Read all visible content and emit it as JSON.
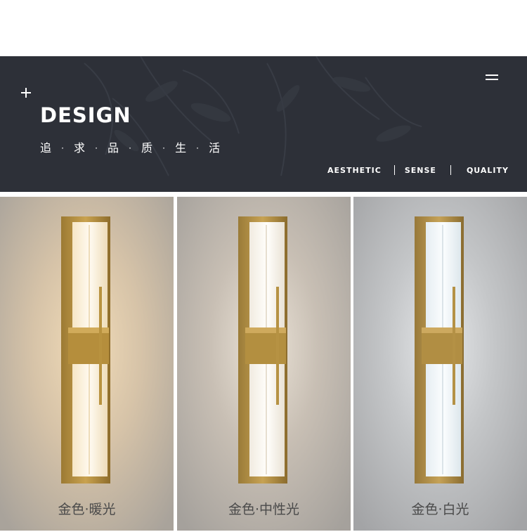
{
  "banner": {
    "title": "DESIGN",
    "slogan_chars": [
      "追",
      "求",
      "品",
      "质",
      "生",
      "活"
    ],
    "slogan_separator": "·",
    "keywords": [
      "AESTHETIC",
      "SENSE",
      "QUALITY"
    ],
    "background_color": "#2d3038",
    "icons": [
      "plus-icon",
      "menu-icon"
    ]
  },
  "variants": [
    {
      "caption": "金色·暖光",
      "tone": "warm"
    },
    {
      "caption": "金色·中性光",
      "tone": "neutral"
    },
    {
      "caption": "金色·白光",
      "tone": "white"
    }
  ]
}
